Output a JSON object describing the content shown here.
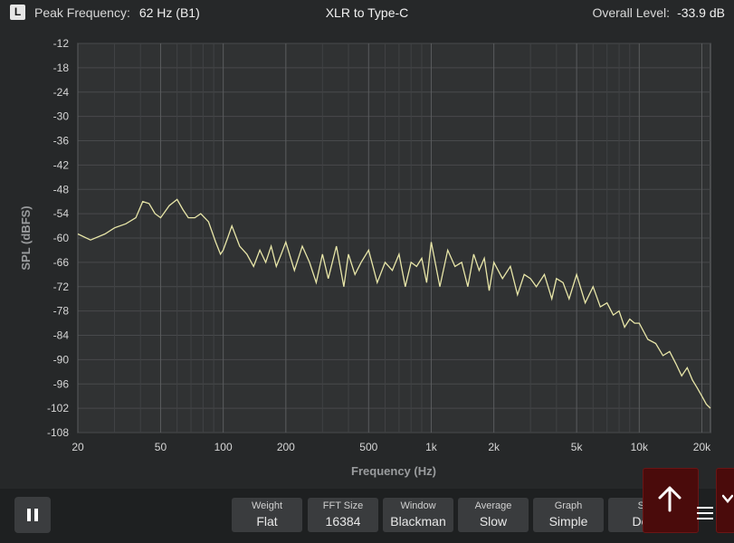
{
  "header": {
    "channel": "L",
    "peak_label": "Peak Frequency:",
    "peak_value": "62 Hz (B1)",
    "title": "XLR to Type-C",
    "overall_label": "Overall Level:",
    "overall_value": "-33.9 dB"
  },
  "toolbar": {
    "settings": [
      {
        "label": "Weight",
        "value": "Flat"
      },
      {
        "label": "FFT Size",
        "value": "16384"
      },
      {
        "label": "Window",
        "value": "Blackman"
      },
      {
        "label": "Average",
        "value": "Slow"
      },
      {
        "label": "Graph",
        "value": "Simple"
      },
      {
        "label": "Sc",
        "value": "Dec"
      }
    ]
  },
  "chart_data": {
    "type": "line",
    "xlabel": "Frequency (Hz)",
    "ylabel": "SPL (dBFS)",
    "xscale": "log",
    "xlim": [
      20,
      22000
    ],
    "ylim": [
      -108,
      -12
    ],
    "grid": true,
    "x_ticks": [
      20,
      50,
      100,
      200,
      500,
      1000,
      2000,
      5000,
      10000,
      20000
    ],
    "x_tick_labels": [
      "20",
      "50",
      "100",
      "200",
      "500",
      "1k",
      "2k",
      "5k",
      "10k",
      "20k"
    ],
    "y_ticks": [
      -12,
      -18,
      -24,
      -30,
      -36,
      -42,
      -48,
      -54,
      -60,
      -66,
      -72,
      -78,
      -84,
      -90,
      -96,
      -102,
      -108
    ],
    "line_color": "#e8e6a8",
    "series": [
      {
        "x": [
          20,
          23,
          27,
          30,
          34,
          38,
          41,
          44,
          47,
          50,
          55,
          60,
          64,
          68,
          73,
          78,
          85,
          92,
          97,
          100,
          105,
          110,
          120,
          130,
          140,
          150,
          160,
          170,
          180,
          190,
          200,
          220,
          240,
          260,
          280,
          300,
          320,
          350,
          380,
          400,
          430,
          460,
          500,
          550,
          600,
          650,
          700,
          750,
          800,
          850,
          900,
          950,
          1000,
          1100,
          1200,
          1300,
          1400,
          1500,
          1600,
          1700,
          1800,
          1900,
          2000,
          2200,
          2400,
          2600,
          2800,
          3000,
          3200,
          3500,
          3800,
          4000,
          4300,
          4600,
          5000,
          5500,
          6000,
          6500,
          7000,
          7500,
          8000,
          8500,
          9000,
          9500,
          10000,
          11000,
          12000,
          13000,
          14000,
          15000,
          16000,
          17000,
          18000,
          19000,
          20000,
          21000,
          22000
        ],
        "y": [
          -59,
          -60.5,
          -59,
          -57.5,
          -56.5,
          -55,
          -51,
          -51.5,
          -54,
          -55,
          -52,
          -50.5,
          -53,
          -55,
          -55,
          -54,
          -56,
          -61,
          -64,
          -63,
          -60,
          -57,
          -62,
          -64,
          -67,
          -63,
          -66,
          -62,
          -67,
          -64,
          -61,
          -68,
          -62,
          -66,
          -71,
          -64,
          -70,
          -62,
          -72,
          -64,
          -69,
          -66,
          -63,
          -71,
          -66,
          -68,
          -64,
          -72,
          -66,
          -67,
          -65,
          -71,
          -61,
          -72,
          -63,
          -67,
          -66,
          -72,
          -64,
          -68,
          -65,
          -73,
          -66,
          -70,
          -67,
          -74,
          -69,
          -70,
          -72,
          -69,
          -75,
          -70,
          -71,
          -75,
          -69,
          -76,
          -72,
          -77,
          -76,
          -79,
          -78,
          -82,
          -80,
          -81,
          -81,
          -85,
          -86,
          -89,
          -88,
          -91,
          -94,
          -92,
          -95,
          -97,
          -99,
          -101,
          -102
        ]
      }
    ]
  }
}
